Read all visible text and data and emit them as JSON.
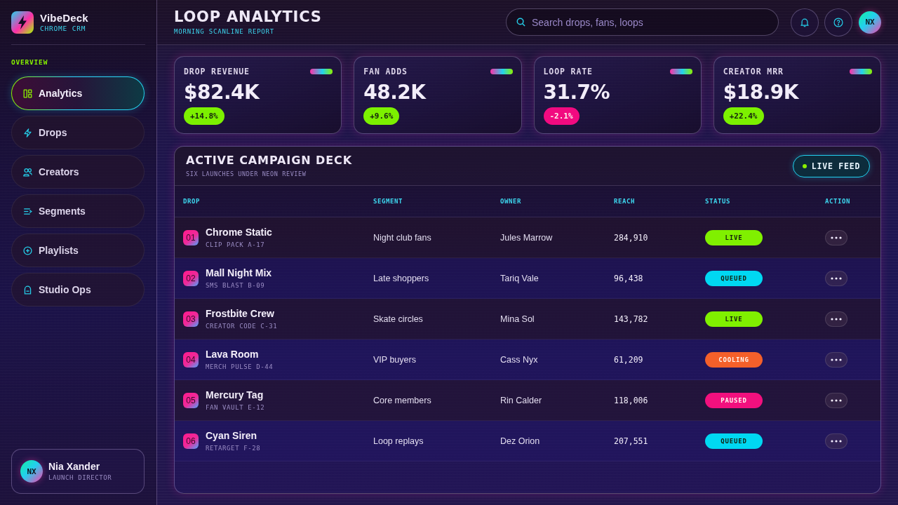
{
  "sidebar": {
    "brand": {
      "name": "VibeDeck",
      "tagline": "CHROME CRM"
    },
    "section_label": "OVERVIEW",
    "items": [
      {
        "label": "Analytics",
        "selected": true
      },
      {
        "label": "Drops",
        "selected": false
      },
      {
        "label": "Creators",
        "selected": false
      },
      {
        "label": "Segments",
        "selected": false
      },
      {
        "label": "Playlists",
        "selected": false
      },
      {
        "label": "Studio Ops",
        "selected": false
      }
    ],
    "user": {
      "initials": "NX",
      "name": "Nia Xander",
      "role": "LAUNCH DIRECTOR"
    }
  },
  "header": {
    "title": "LOOP ANALYTICS",
    "subtitle": "MORNING SCANLINE REPORT",
    "search": {
      "placeholder": "Search drops, fans, loops"
    },
    "avatar": {
      "initials": "NX"
    }
  },
  "kpis": [
    {
      "label": "DROP REVENUE",
      "value": "$82.4K",
      "delta": {
        "text": "+14.8%",
        "color": "#7cf000"
      }
    },
    {
      "label": "FAN ADDS",
      "value": "48.2K",
      "delta": {
        "text": "+9.6%",
        "color": "#7cf000"
      }
    },
    {
      "label": "LOOP RATE",
      "value": "31.7%",
      "delta": {
        "text": "-2.1%",
        "color": "#f20a80"
      }
    },
    {
      "label": "CREATOR MRR",
      "value": "$18.9K",
      "delta": {
        "text": "+22.4%",
        "color": "#7cf000"
      }
    }
  ],
  "campaigns": {
    "title": "ACTIVE CAMPAIGN DECK",
    "subtitle": "SIX LAUNCHES UNDER NEON REVIEW",
    "live_feed": {
      "label": "LIVE FEED"
    },
    "table": {
      "columns": [
        "DROP",
        "SEGMENT",
        "OWNER",
        "REACH",
        "STATUS",
        "ACTION"
      ],
      "rows": [
        {
          "number": "01",
          "name": "Chrome Static",
          "code": "CLIP PACK A-17",
          "segment": "Night club fans",
          "owner": "Jules Marrow",
          "reach": "284,910",
          "status": {
            "label": "LIVE",
            "color": "#80f000"
          }
        },
        {
          "number": "02",
          "name": "Mall Night Mix",
          "code": "SMS BLAST B-09",
          "segment": "Late shoppers",
          "owner": "Tariq Vale",
          "reach": "96,438",
          "status": {
            "label": "QUEUED",
            "color": "#00d8f2"
          }
        },
        {
          "number": "03",
          "name": "Frostbite Crew",
          "code": "CREATOR CODE C-31",
          "segment": "Skate circles",
          "owner": "Mina Sol",
          "reach": "143,782",
          "status": {
            "label": "LIVE",
            "color": "#80f000"
          }
        },
        {
          "number": "04",
          "name": "Lava Room",
          "code": "MERCH PULSE D-44",
          "segment": "VIP buyers",
          "owner": "Cass Nyx",
          "reach": "61,209",
          "status": {
            "label": "COOLING",
            "color": "#f4602a"
          }
        },
        {
          "number": "05",
          "name": "Mercury Tag",
          "code": "FAN VAULT E-12",
          "segment": "Core members",
          "owner": "Rin Calder",
          "reach": "118,006",
          "status": {
            "label": "PAUSED",
            "color": "#f2107e"
          }
        },
        {
          "number": "06",
          "name": "Cyan Siren",
          "code": "RETARGET F-28",
          "segment": "Loop replays",
          "owner": "Dez Orion",
          "reach": "207,551",
          "status": {
            "label": "QUEUED",
            "color": "#00d8f2"
          }
        }
      ]
    }
  }
}
